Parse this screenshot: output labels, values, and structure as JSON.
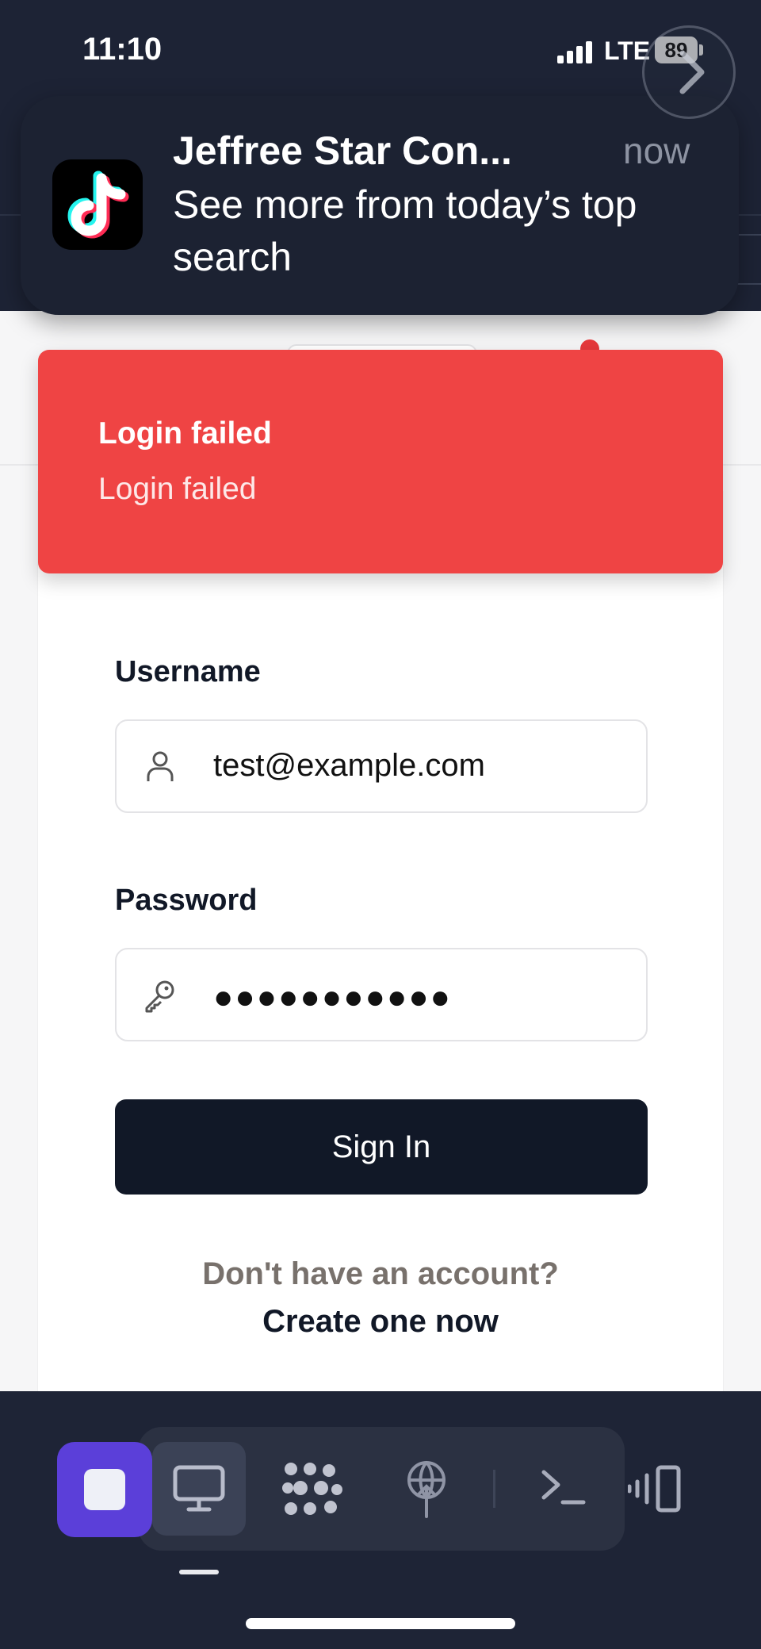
{
  "status_bar": {
    "time": "11:10",
    "network": "LTE",
    "battery": "89"
  },
  "notification": {
    "app_icon": "tiktok-icon",
    "title": "Jeffree Star Con...",
    "time": "now",
    "body": "See more from today’s top search"
  },
  "toast": {
    "title": "Login failed",
    "description": "Login failed",
    "color": "#ef4444"
  },
  "form": {
    "username_label": "Username",
    "username_value": "test@example.com",
    "password_label": "Password",
    "password_value": "●●●●●●●●●●●",
    "signin_label": "Sign In",
    "no_account_text": "Don't have an account?",
    "create_link": "Create one now"
  },
  "dock": {
    "icons": [
      "stop-icon",
      "monitor-icon",
      "cluster-icon",
      "antenna-icon",
      "terminal-icon",
      "devices-icon"
    ],
    "accent": "#5b3fd9"
  }
}
